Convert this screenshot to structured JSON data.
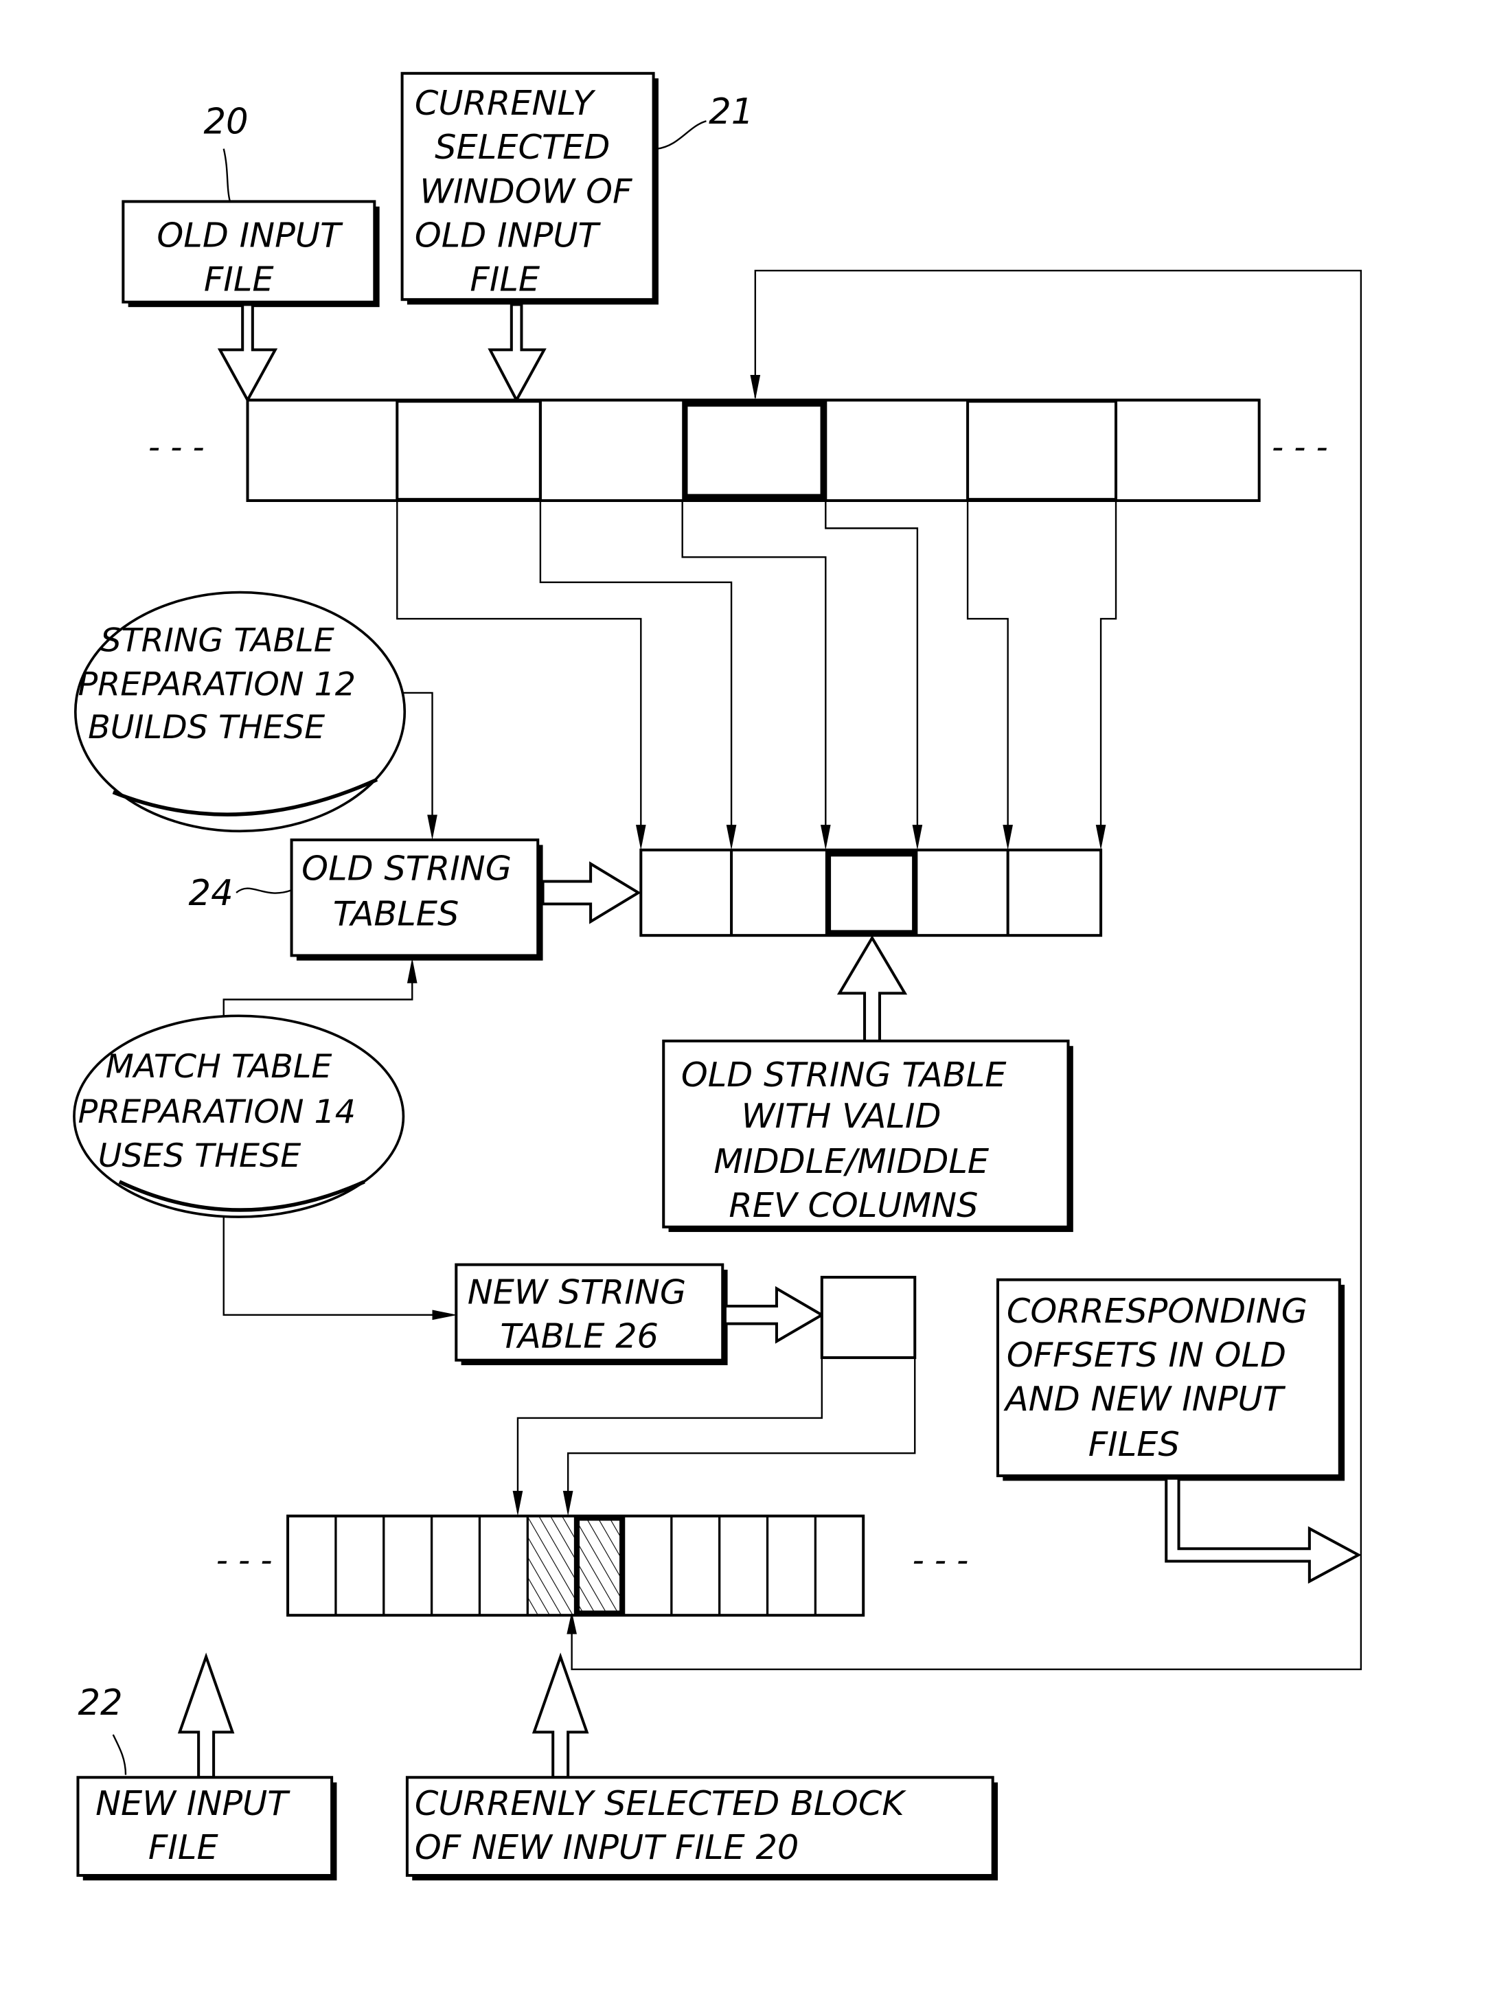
{
  "figure": {
    "refs": {
      "old_input": "20",
      "window": "21",
      "old_tables": "24",
      "new_input": "22"
    },
    "boxes": {
      "old_input_file": [
        "OLD INPUT",
        "FILE"
      ],
      "current_window": [
        "CURRENLY",
        "SELECTED",
        "WINDOW OF",
        "OLD  INPUT",
        "FILE"
      ],
      "old_string_tables": [
        "OLD STRING",
        "TABLES"
      ],
      "old_string_table_valid": [
        "OLD  STRING TABLE",
        "WITH VALID",
        "MIDDLE/MIDDLE",
        "REV  COLUMNS"
      ],
      "new_string_table": [
        "NEW STRING",
        "TABLE  26"
      ],
      "corresponding_offsets": [
        "CORRESPONDING",
        "OFFSETS IN OLD",
        "AND NEW INPUT",
        "FILES"
      ],
      "new_input_file": [
        "NEW INPUT",
        "FILE"
      ],
      "current_block": [
        "CURRENLY SELECTED BLOCK",
        "OF NEW INPUT FILE  20"
      ]
    },
    "ellipses": {
      "string_table_prep": [
        "STRING TABLE",
        "PREPARATION 12",
        "BUILDS THESE"
      ],
      "match_table_prep": [
        "MATCH TABLE",
        "PREPARATION 14",
        "USES THESE"
      ]
    },
    "continuation": "- - -",
    "strips": {
      "old_file_cells": 7,
      "old_file_selected_cell": 4,
      "old_string_table_cells": 5,
      "old_string_table_selected_cell": 3,
      "new_file_cells": 12,
      "new_file_hatched_cells": [
        6,
        7
      ],
      "new_file_selected_cell": 7
    }
  }
}
